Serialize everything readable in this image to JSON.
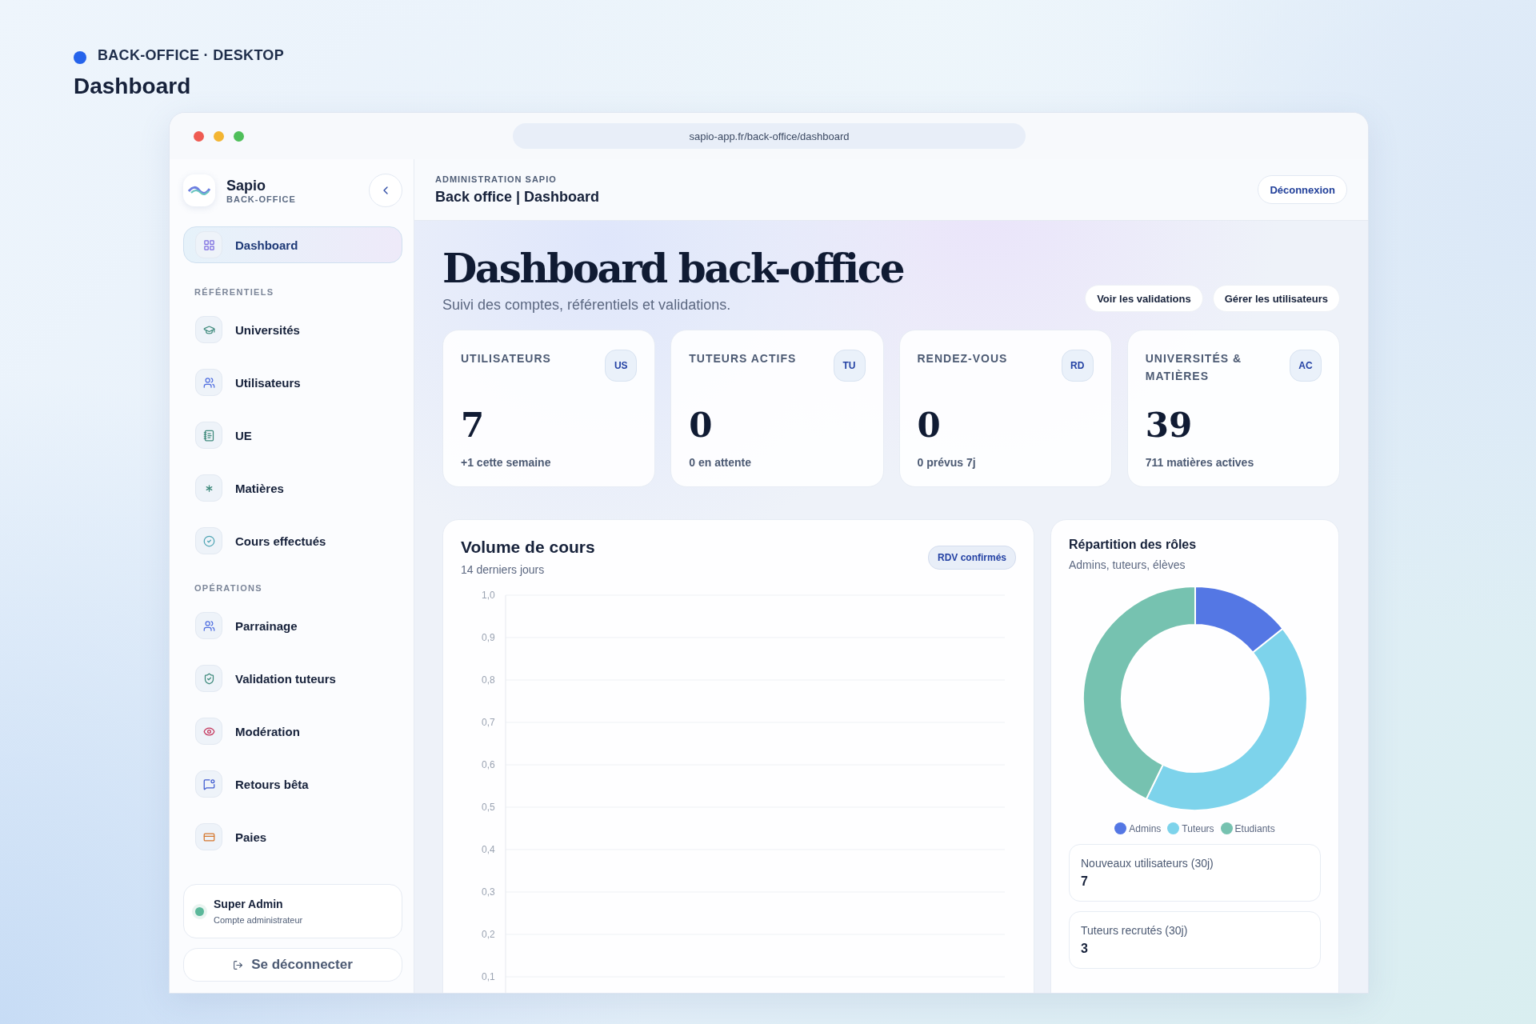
{
  "page_header": {
    "eyebrow": "BACK-OFFICE · DESKTOP",
    "title": "Dashboard"
  },
  "browser": {
    "url": "sapio-app.fr/back-office/dashboard"
  },
  "sidebar": {
    "brand": "Sapio",
    "brand_sub": "BACK-OFFICE",
    "items": [
      {
        "label": "Dashboard",
        "selected": true
      }
    ],
    "sections": [
      {
        "title": "RÉFÉRENTIELS",
        "items": [
          {
            "label": "Universités",
            "selected": false
          },
          {
            "label": "Utilisateurs",
            "selected": false
          },
          {
            "label": "UE",
            "selected": false
          },
          {
            "label": "Matières",
            "selected": false
          },
          {
            "label": "Cours effectués",
            "selected": false
          }
        ]
      },
      {
        "title": "OPÉRATIONS",
        "items": [
          {
            "label": "Parrainage",
            "selected": false
          },
          {
            "label": "Validation tuteurs",
            "selected": false
          },
          {
            "label": "Modération",
            "selected": false
          },
          {
            "label": "Retours bêta",
            "selected": false
          },
          {
            "label": "Paies",
            "selected": false
          }
        ]
      }
    ],
    "user": {
      "name": "Super Admin",
      "role": "Compte administrateur"
    },
    "logout": "Se déconnecter"
  },
  "topbar": {
    "eyebrow": "ADMINISTRATION SAPIO",
    "title": "Back office | Dashboard",
    "button": "Déconnexion"
  },
  "hero": {
    "title": "Dashboard back-office",
    "subtitle": "Suivi des comptes, référentiels et validations.",
    "buttons": [
      "Voir les validations",
      "Gérer les utilisateurs"
    ]
  },
  "kpis": [
    {
      "label": "UTILISATEURS",
      "badge": "US",
      "value": "7",
      "note": "+1 cette semaine"
    },
    {
      "label": "TUTEURS ACTIFS",
      "badge": "TU",
      "value": "0",
      "note": "0 en attente"
    },
    {
      "label": "RENDEZ-VOUS",
      "badge": "RD",
      "value": "0",
      "note": "0 prévus 7j"
    },
    {
      "label": "UNIVERSITÉS & MATIÈRES",
      "badge": "AC",
      "value": "39",
      "note": "711 matières actives"
    }
  ],
  "volume_card": {
    "title": "Volume de cours",
    "subtitle": "14 derniers jours",
    "badge": "RDV confirmés",
    "axis_labels": [
      "1,0",
      "0,9",
      "0,8",
      "0,7",
      "0,6",
      "0,5",
      "0,4",
      "0,3",
      "0,2",
      "0,1"
    ]
  },
  "roles_card": {
    "title": "Répartition des rôles",
    "subtitle": "Admins, tuteurs, élèves",
    "chart_data": {
      "type": "donut",
      "categories": [
        "Admins",
        "Tuteurs",
        "Etudiants"
      ],
      "values": [
        14.3,
        42.9,
        42.8
      ],
      "colors": [
        "#5477e4",
        "#7dd3eb",
        "#76c2b0"
      ]
    },
    "stats": [
      {
        "label": "Nouveaux utilisateurs (30j)",
        "value": "7"
      },
      {
        "label": "Tuteurs recrutés (30j)",
        "value": "3"
      }
    ]
  }
}
